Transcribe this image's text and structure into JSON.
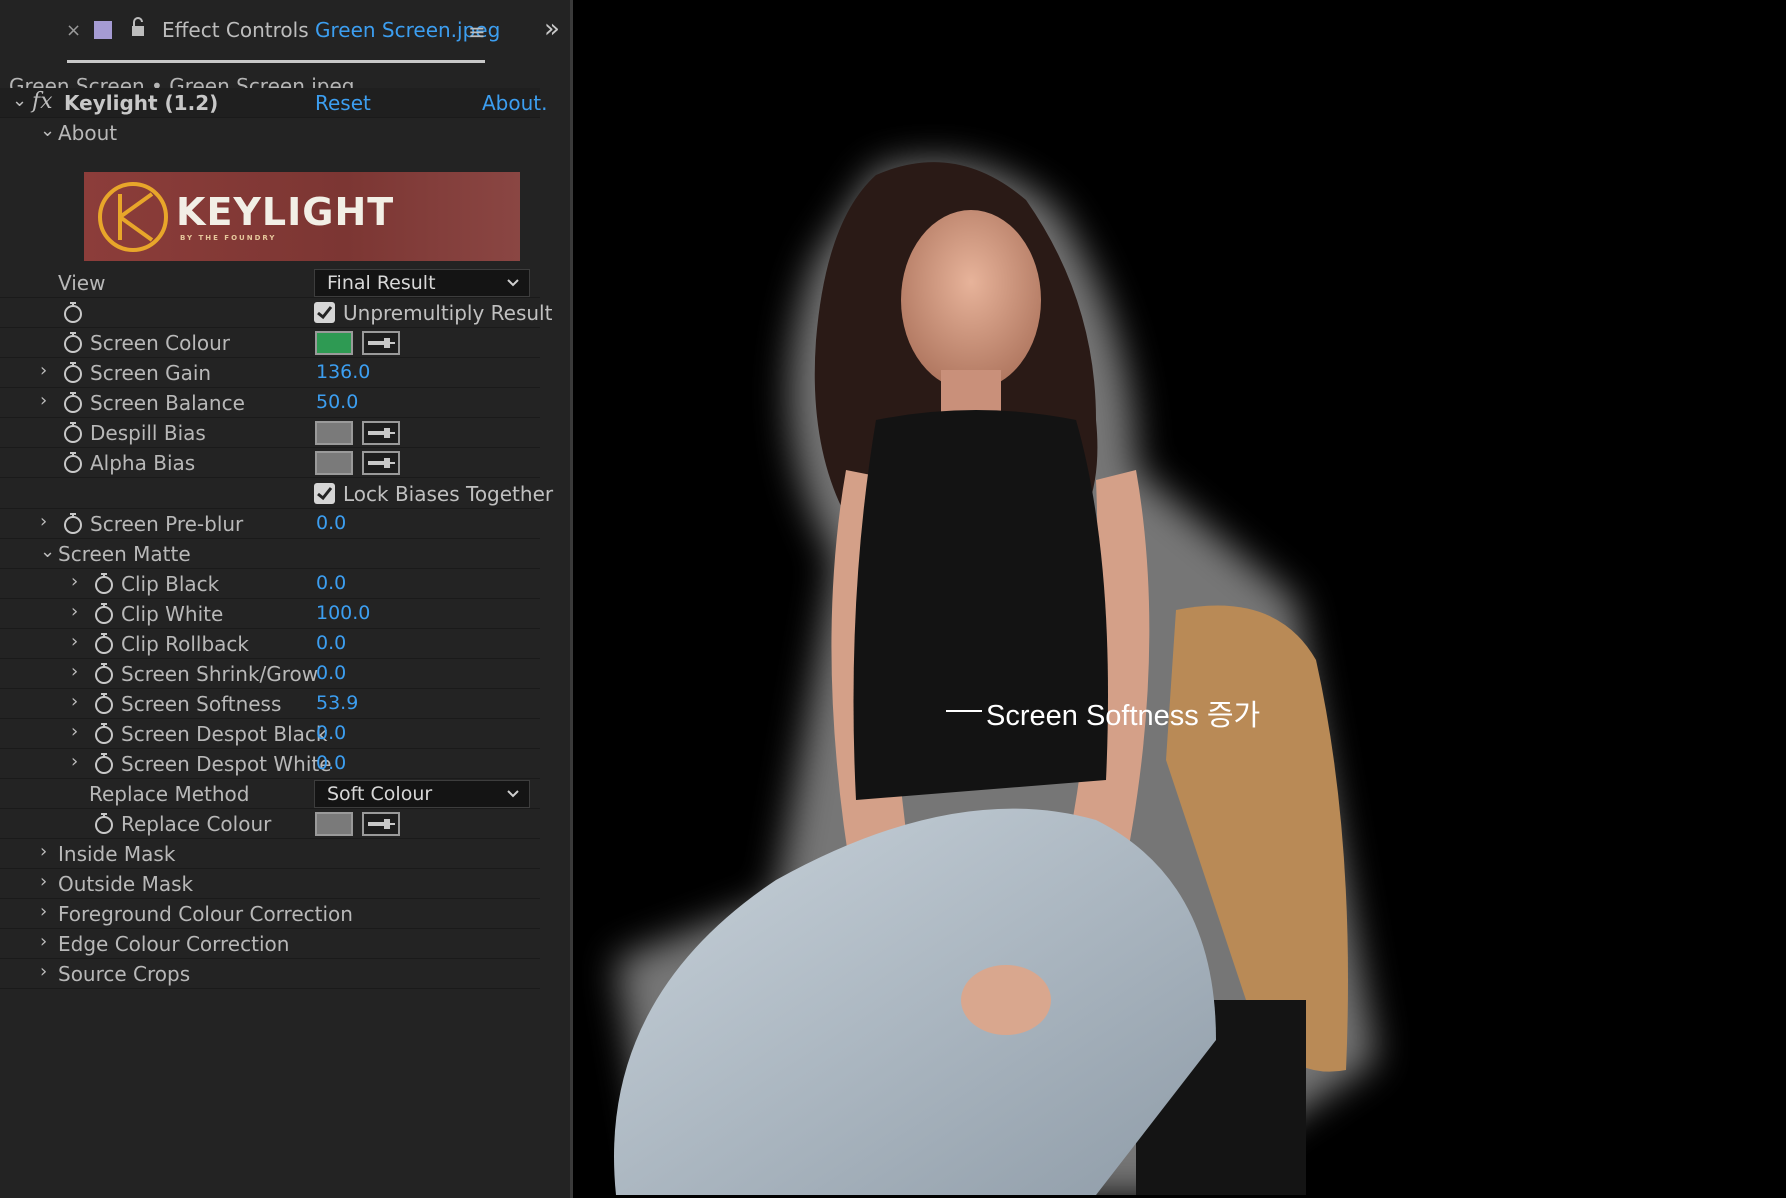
{
  "panel": {
    "tab_title": "Effect Controls",
    "tab_file": "Green Screen.jpeg",
    "layer_path": "Green Screen • Green Screen.jpeg"
  },
  "effect": {
    "name": "Keylight (1.2)",
    "reset_label": "Reset",
    "about_label": "About.",
    "about_group": "About",
    "logo_text": "KEYLIGHT",
    "logo_subtext": "BY THE FOUNDRY"
  },
  "params": {
    "view_label": "View",
    "view_value": "Final Result",
    "unpremultiply_label": "Unpremultiply Result",
    "screen_colour_label": "Screen Colour",
    "screen_colour_value": "#2e9a53",
    "screen_gain_label": "Screen Gain",
    "screen_gain_value": "136.0",
    "screen_balance_label": "Screen Balance",
    "screen_balance_value": "50.0",
    "despill_bias_label": "Despill Bias",
    "alpha_bias_label": "Alpha Bias",
    "lock_biases_label": "Lock Biases Together",
    "screen_preblur_label": "Screen Pre-blur",
    "screen_preblur_value": "0.0",
    "screen_matte_label": "Screen Matte",
    "clip_black_label": "Clip Black",
    "clip_black_value": "0.0",
    "clip_white_label": "Clip White",
    "clip_white_value": "100.0",
    "clip_rollback_label": "Clip Rollback",
    "clip_rollback_value": "0.0",
    "shrink_grow_label": "Screen Shrink/Grow",
    "shrink_grow_value": "0.0",
    "softness_label": "Screen Softness",
    "softness_value": "53.9",
    "despot_black_label": "Screen Despot Black",
    "despot_black_value": "0.0",
    "despot_white_label": "Screen Despot White",
    "despot_white_value": "0.0",
    "replace_method_label": "Replace Method",
    "replace_method_value": "Soft Colour",
    "replace_colour_label": "Replace Colour",
    "inside_mask_label": "Inside Mask",
    "outside_mask_label": "Outside Mask",
    "fg_correction_label": "Foreground Colour Correction",
    "edge_correction_label": "Edge Colour Correction",
    "source_crops_label": "Source Crops"
  },
  "viewer": {
    "annotation": "Screen Softness 증가"
  }
}
